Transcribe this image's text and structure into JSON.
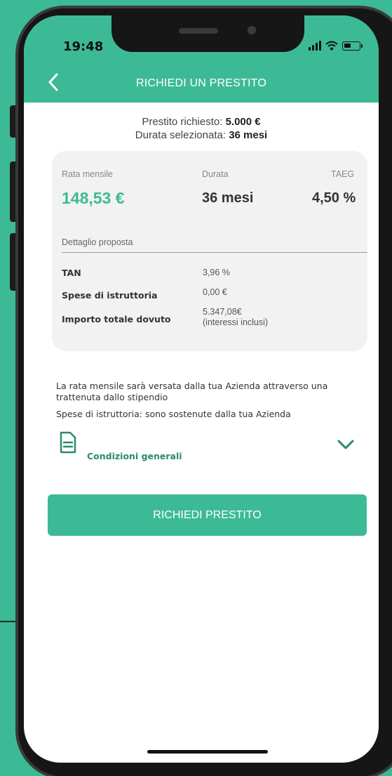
{
  "status_bar": {
    "time": "19:48"
  },
  "header": {
    "title": "RICHIEDI UN PRESTITO"
  },
  "summary": {
    "amount_label": "Prestito richiesto:",
    "amount_value": "5.000 €",
    "duration_label": "Durata selezionata:",
    "duration_value": "36 mesi"
  },
  "card": {
    "rata_label": "Rata mensile",
    "rata_value": "148,53 €",
    "durata_label": "Durata",
    "durata_value": "36 mesi",
    "taeg_label": "TAEG",
    "taeg_value": "4,50 %",
    "detail_title": "Dettaglio proposta",
    "rows": [
      {
        "label": "TAN",
        "value": "3,96 %"
      },
      {
        "label": "Spese di istruttoria",
        "value": "0,00 €"
      },
      {
        "label": "Importo totale dovuto",
        "value": "5.347,08€",
        "note": "(interessi inclusi)"
      }
    ]
  },
  "info": {
    "line1": "La rata mensile sarà versata dalla tua Azienda attraverso una trattenuta dallo stipendio",
    "line2": "Spese di istruttoria: sono sostenute dalla tua Azienda"
  },
  "conditions": {
    "label": "Condizioni generali",
    "icon": "document-icon"
  },
  "cta": {
    "label": "RICHIEDI PRESTITO"
  },
  "colors": {
    "accent": "#3cba95",
    "background": "#3cba95"
  }
}
